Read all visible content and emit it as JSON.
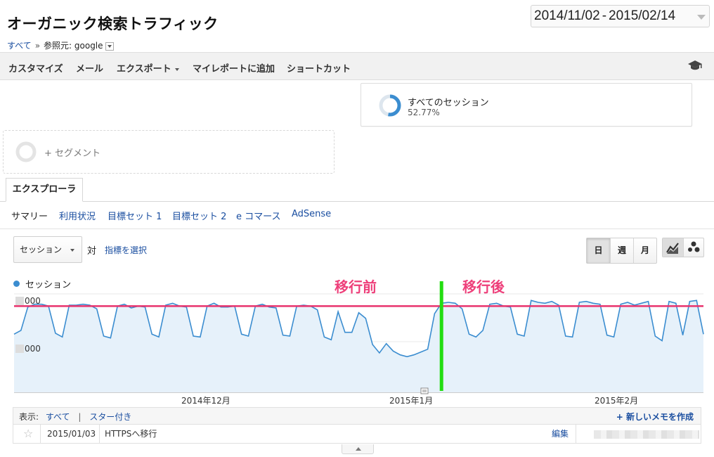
{
  "header": {
    "title": "オーガニック検索トラフィック",
    "date_start": "2014/11/02",
    "date_sep": "-",
    "date_end": "2015/02/14"
  },
  "breadcrumb": {
    "all": "すべて",
    "separator": "»",
    "filter": "参照元: google"
  },
  "toolbar": {
    "customize": "カスタマイズ",
    "email": "メール",
    "export": "エクスポート",
    "add_dashboard": "マイレポートに追加",
    "shortcut": "ショートカット"
  },
  "segments": {
    "all_sessions_name": "すべてのセッション",
    "all_sessions_pct": "52.77%",
    "all_sessions_fraction": 0.5277,
    "add_segment": "+ セグメント"
  },
  "tabs": {
    "explorer": "エクスプローラ",
    "subtabs": [
      "サマリー",
      "利用状況",
      "目標セット 1",
      "目標セット 2",
      "e コマース",
      "AdSense"
    ]
  },
  "controls": {
    "metric": "セッション",
    "vs": "対",
    "select_metric": "指標を選択",
    "granularity": [
      "日",
      "週",
      "月"
    ]
  },
  "annotations": {
    "before": "移行前",
    "after": "移行後"
  },
  "notes": {
    "show_label": "表示:",
    "all": "すべて",
    "pipe": "|",
    "starred": "スター付き",
    "new_note": "+ 新しいメモを作成",
    "row_date": "2015/01/03",
    "row_text": "HTTPSへ移行",
    "row_edit": "編集"
  },
  "colors": {
    "series": "#3b8dd0",
    "fill": "#e6f1fa",
    "average_line": "#e8336d",
    "marker_line": "#22dd11",
    "annotation_text": "#ee3f7a"
  },
  "chart_data": {
    "type": "area",
    "series": [
      {
        "name": "セッション",
        "values": [
          62,
          66,
          91,
          94,
          94,
          92,
          63,
          59,
          93,
          93,
          94,
          93,
          89,
          60,
          58,
          92,
          94,
          90,
          92,
          91,
          62,
          59,
          93,
          95,
          92,
          91,
          60,
          59,
          92,
          95,
          91,
          91,
          92,
          62,
          60,
          92,
          94,
          91,
          90,
          61,
          60,
          92,
          93,
          92,
          88,
          59,
          56,
          86,
          64,
          64,
          85,
          79,
          51,
          42,
          52,
          44,
          40,
          38,
          40,
          43,
          46,
          84,
          95,
          96,
          95,
          89,
          62,
          59,
          66,
          94,
          95,
          92,
          91,
          62,
          60,
          98,
          96,
          95,
          97,
          93,
          60,
          59,
          96,
          97,
          95,
          94,
          61,
          59,
          94,
          96,
          93,
          95,
          97,
          60,
          55,
          97,
          95,
          61,
          97,
          98,
          62
        ]
      }
    ],
    "x_start": "2014/11/02",
    "x_end": "2015/02/14",
    "x_ticks": [
      "2014年12月",
      "2015年1月",
      "2015年2月"
    ],
    "y_ticks": [
      "000",
      "000"
    ],
    "average_value": 92,
    "marker_date": "2015/01/03",
    "grid": true,
    "legend": "top-left"
  }
}
